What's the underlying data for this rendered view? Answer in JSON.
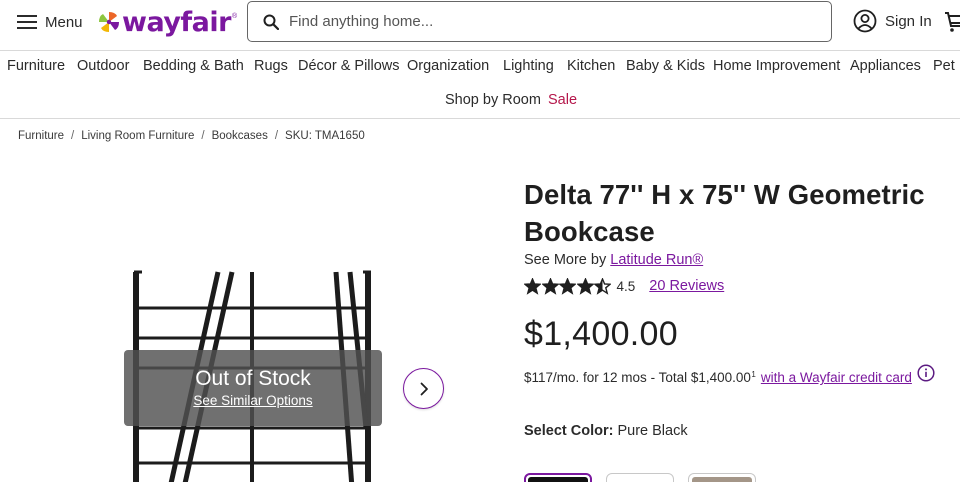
{
  "header": {
    "menu_label": "Menu",
    "logo_text": "wayfair",
    "logo_tm": "®",
    "search_placeholder": "Find anything home...",
    "signin_label": "Sign In",
    "brand_color": "#7b189f"
  },
  "nav": {
    "categories": [
      "Furniture",
      "Outdoor",
      "Bedding & Bath",
      "Rugs",
      "Décor & Pillows",
      "Organization",
      "Lighting",
      "Kitchen",
      "Baby & Kids",
      "Home Improvement",
      "Appliances",
      "Pet"
    ],
    "shop_by_room": "Shop by Room",
    "sale": "Sale",
    "sale_color": "#b5174b"
  },
  "breadcrumb": {
    "items": [
      "Furniture",
      "Living Room Furniture",
      "Bookcases",
      "SKU: TMA1650"
    ],
    "separator": "/"
  },
  "gallery": {
    "out_of_stock": "Out of Stock",
    "see_similar": "See Similar Options"
  },
  "product": {
    "title": "Delta 77'' H x 75'' W Geometric Bookcase",
    "see_more_prefix": "See More by",
    "brand": "Latitude Run®",
    "rating": "4.5",
    "rating_value": 4.5,
    "reviews": "20 Reviews",
    "price": "$1,400.00",
    "finance_text": "$117/mo. for 12 mos - Total $1,400.00",
    "finance_sup": "1",
    "finance_link": "with a Wayfair credit card",
    "select_color_label": "Select Color:",
    "selected_color": "Pure Black",
    "swatch_colors": [
      "#111111",
      "#ffffff",
      "#a49688"
    ]
  }
}
